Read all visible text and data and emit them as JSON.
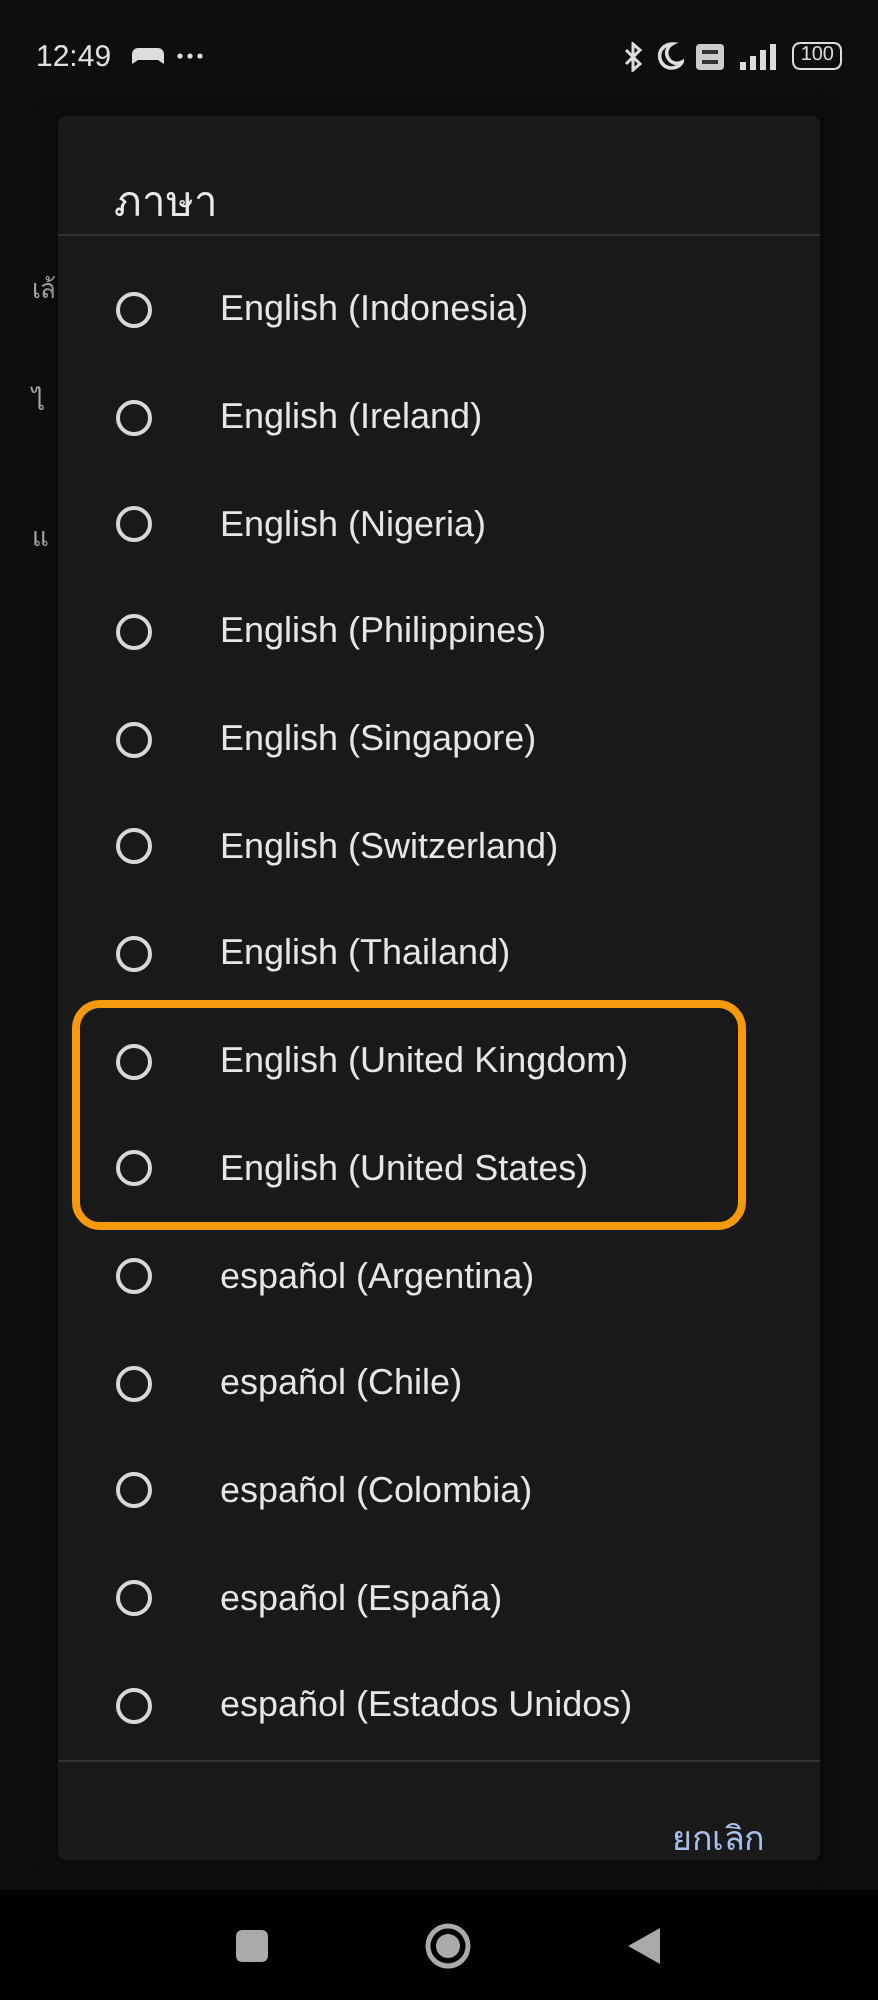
{
  "status_bar": {
    "time": "12:49",
    "battery": "100"
  },
  "background": {
    "texts": [
      "เล้",
      "ไ",
      "แ"
    ]
  },
  "dialog": {
    "title": "ภาษา",
    "options": [
      {
        "label": "English (Indonesia)",
        "selected": false,
        "highlighted": false
      },
      {
        "label": "English (Ireland)",
        "selected": false,
        "highlighted": false
      },
      {
        "label": "English (Nigeria)",
        "selected": false,
        "highlighted": false
      },
      {
        "label": "English (Philippines)",
        "selected": false,
        "highlighted": false
      },
      {
        "label": "English (Singapore)",
        "selected": false,
        "highlighted": false
      },
      {
        "label": "English (Switzerland)",
        "selected": false,
        "highlighted": false
      },
      {
        "label": "English (Thailand)",
        "selected": false,
        "highlighted": false
      },
      {
        "label": "English (United Kingdom)",
        "selected": false,
        "highlighted": true
      },
      {
        "label": "English (United States)",
        "selected": false,
        "highlighted": true
      },
      {
        "label": "español (Argentina)",
        "selected": false,
        "highlighted": false
      },
      {
        "label": "español (Chile)",
        "selected": false,
        "highlighted": false
      },
      {
        "label": "español (Colombia)",
        "selected": false,
        "highlighted": false
      },
      {
        "label": "español (España)",
        "selected": false,
        "highlighted": false
      },
      {
        "label": "español (Estados Unidos)",
        "selected": false,
        "highlighted": false
      }
    ],
    "cancel": "ยกเลิก"
  }
}
